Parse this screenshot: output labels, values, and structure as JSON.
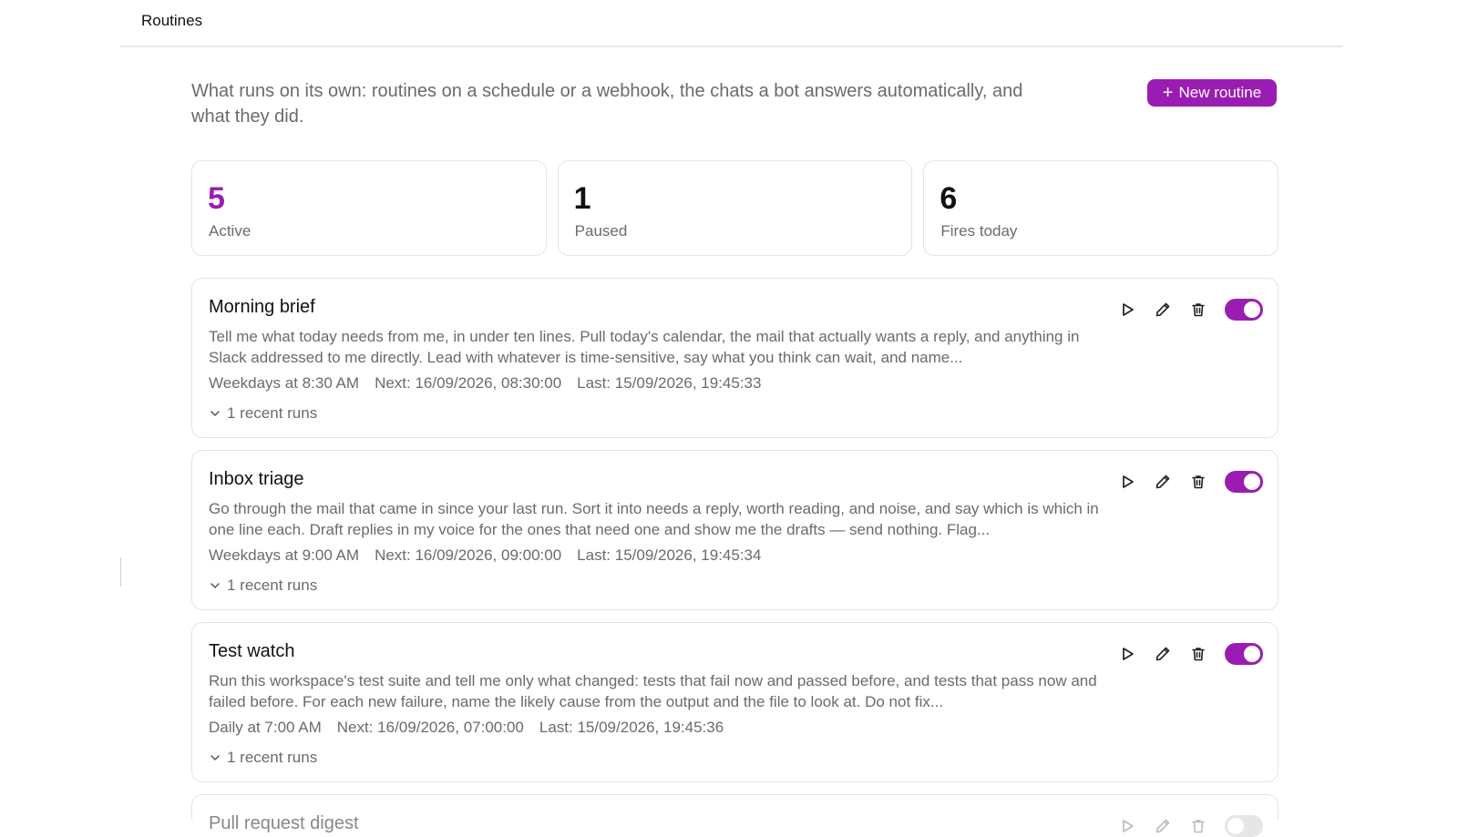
{
  "header": {
    "title": "Routines"
  },
  "intro": "What runs on its own: routines on a schedule or a webhook, the chats a bot answers automatically, and what they did.",
  "new_button": {
    "label": "New routine"
  },
  "stats": [
    {
      "value": "5",
      "label": "Active"
    },
    {
      "value": "1",
      "label": "Paused"
    },
    {
      "value": "6",
      "label": "Fires today"
    }
  ],
  "routines": [
    {
      "name": "Morning brief",
      "description": "Tell me what today needs from me, in under ten lines. Pull today's calendar, the mail that actually wants a reply, and anything in Slack addressed to me directly. Lead with whatever is time-sensitive, say what you think can wait, and name...",
      "schedule": "Weekdays at 8:30 AM",
      "next": "Next: 16/09/2026, 08:30:00",
      "last": "Last: 15/09/2026, 19:45:33",
      "recent_runs": "1 recent runs",
      "enabled": true
    },
    {
      "name": "Inbox triage",
      "description": "Go through the mail that came in since your last run. Sort it into needs a reply, worth reading, and noise, and say which is which in one line each. Draft replies in my voice for the ones that need one and show me the drafts — send nothing. Flag...",
      "schedule": "Weekdays at 9:00 AM",
      "next": "Next: 16/09/2026, 09:00:00",
      "last": "Last: 15/09/2026, 19:45:34",
      "recent_runs": "1 recent runs",
      "enabled": true
    },
    {
      "name": "Test watch",
      "description": "Run this workspace's test suite and tell me only what changed: tests that fail now and passed before, and tests that pass now and failed before. For each new failure, name the likely cause from the output and the file to look at. Do not fix...",
      "schedule": "Daily at 7:00 AM",
      "next": "Next: 16/09/2026, 07:00:00",
      "last": "Last: 15/09/2026, 19:45:36",
      "recent_runs": "1 recent runs",
      "enabled": true
    },
    {
      "name": "Pull request digest",
      "enabled": false
    }
  ],
  "colors": {
    "accent": "#9b1cb3",
    "muted": "#6b6b6b",
    "border": "#e4e4e4"
  }
}
